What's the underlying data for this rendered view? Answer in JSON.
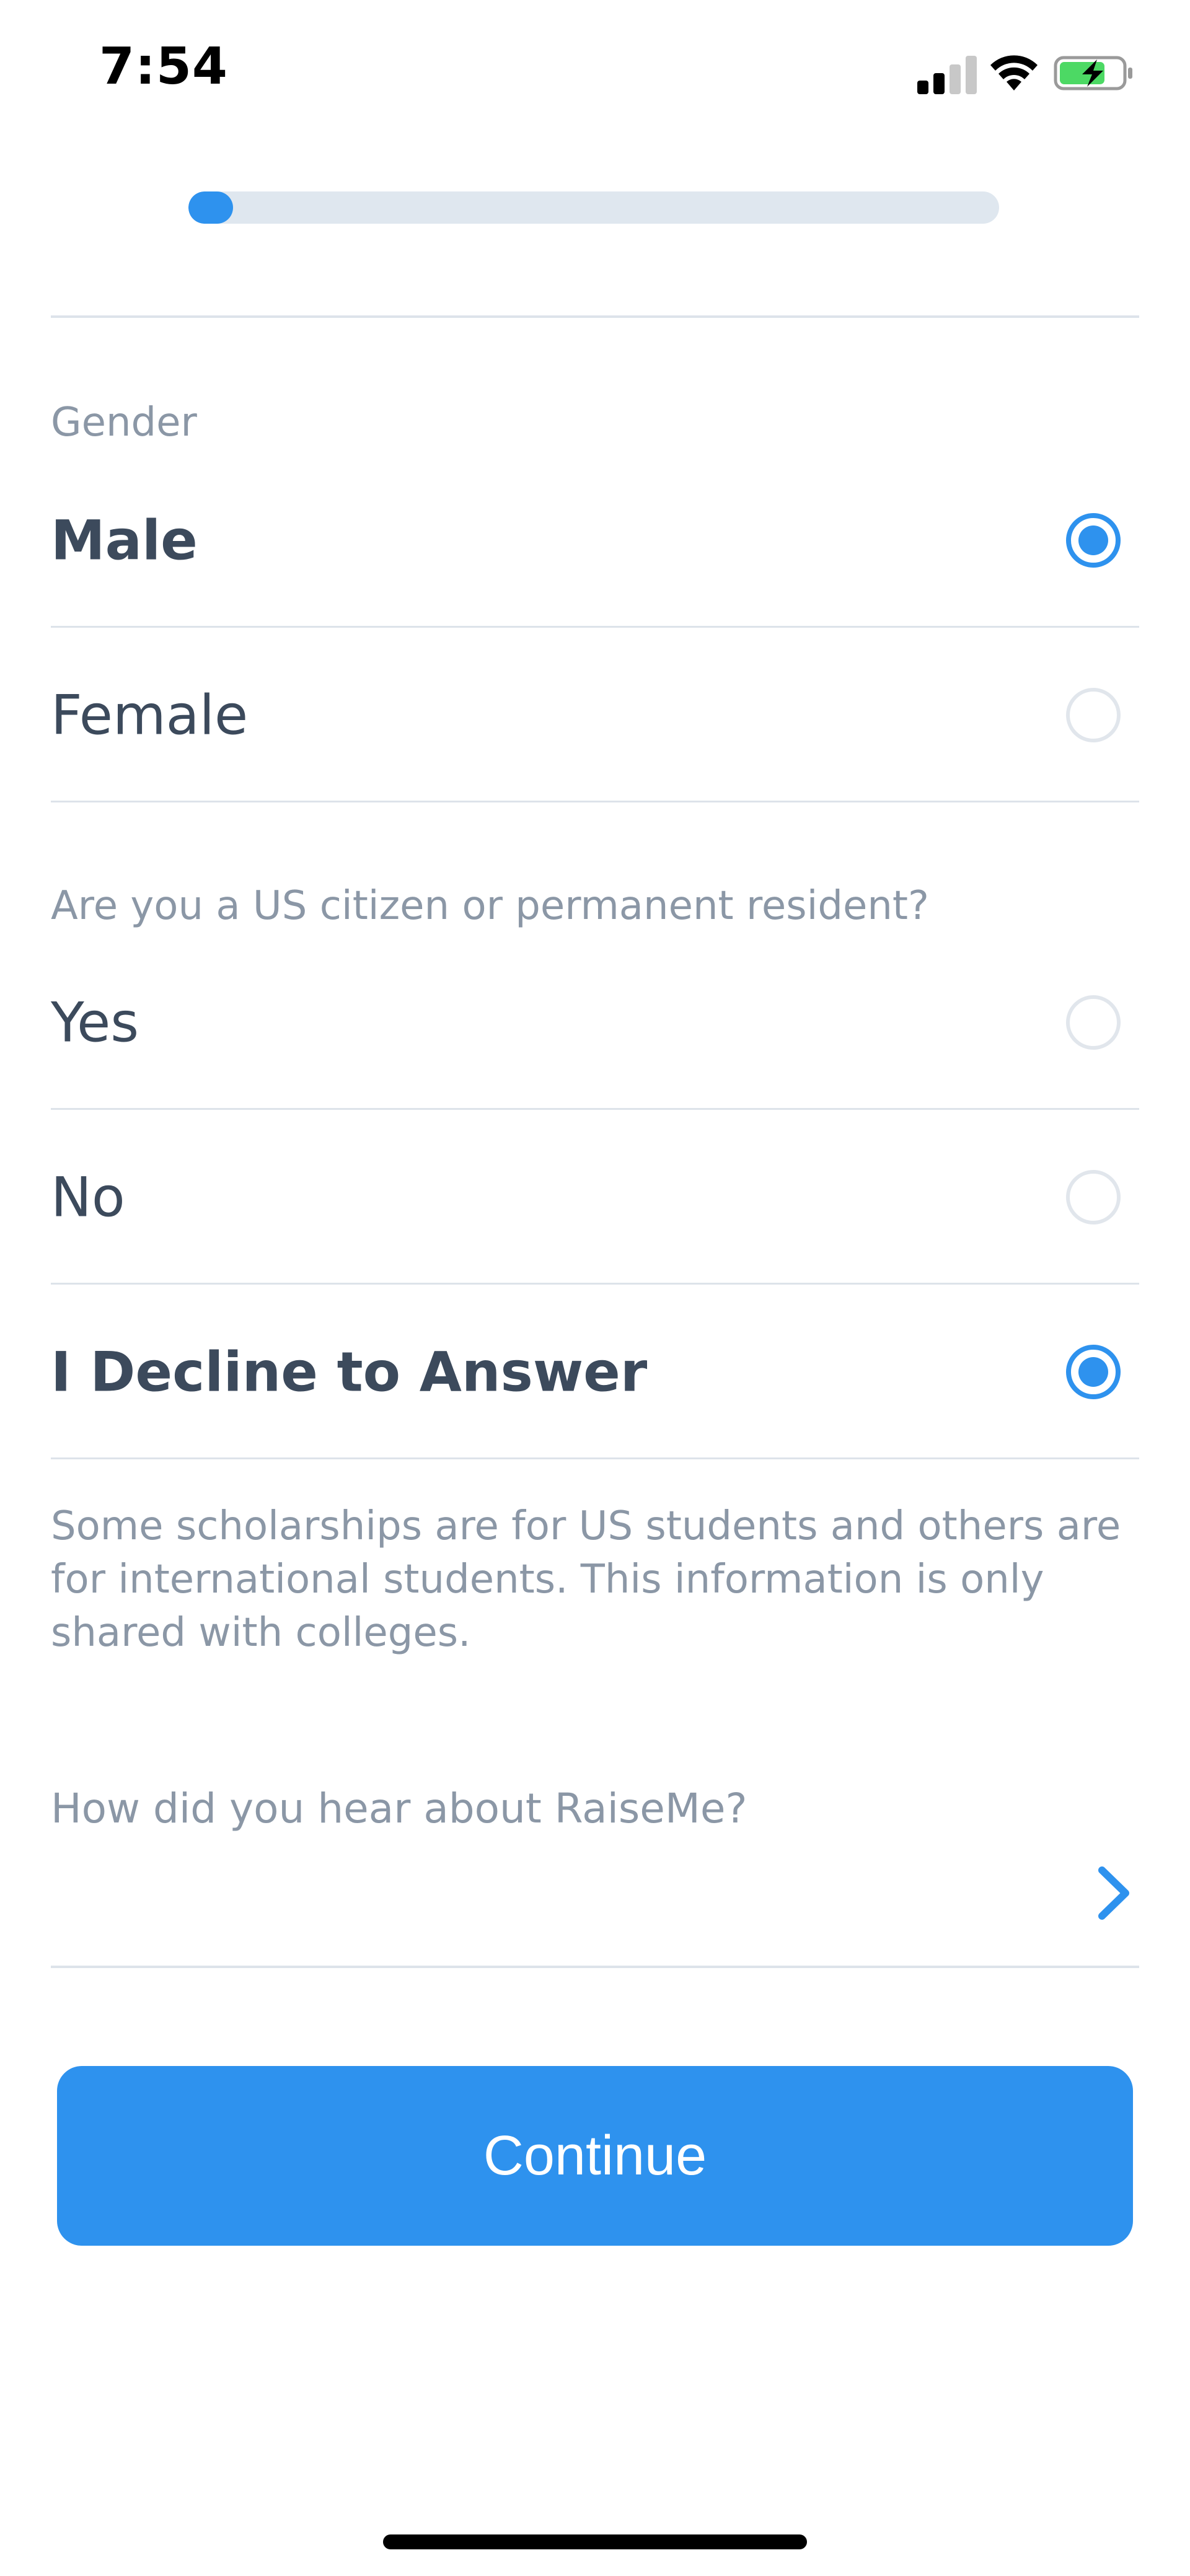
{
  "status_bar": {
    "time": "7:54",
    "icons": [
      "signal-icon",
      "wifi-icon",
      "battery-charging-icon"
    ]
  },
  "progress": {
    "value": 0.055
  },
  "gender": {
    "label": "Gender",
    "options": [
      {
        "label": "Male",
        "selected": true
      },
      {
        "label": "Female",
        "selected": false
      }
    ]
  },
  "citizenship": {
    "label": "Are you a US citizen or permanent resident?",
    "options": [
      {
        "label": "Yes",
        "selected": false
      },
      {
        "label": "No",
        "selected": false
      },
      {
        "label": "I Decline to Answer",
        "selected": true
      }
    ],
    "help_text": "Some scholarships are for US students and others are for international students. This information is only shared with colleges."
  },
  "referral": {
    "label": "How did you hear about RaiseMe?",
    "value": ""
  },
  "continue_label": "Continue",
  "colors": {
    "accent": "#2e92ee",
    "text": "#3c4a5c",
    "muted": "#8b97a6",
    "divider": "#dde3ea",
    "track": "#dfe7ef"
  }
}
